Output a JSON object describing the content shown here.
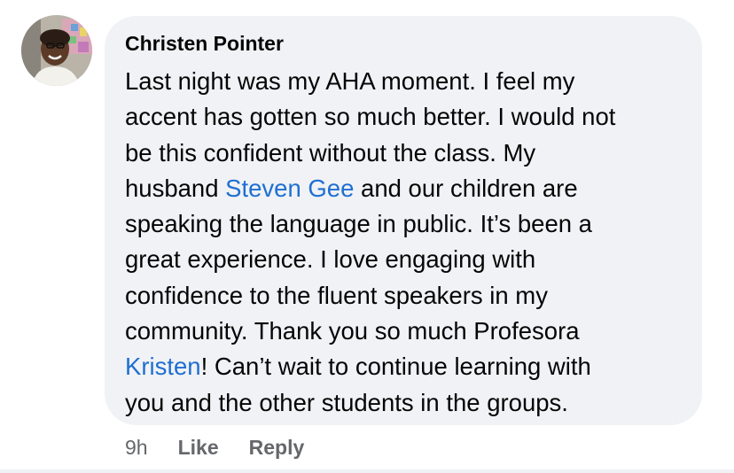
{
  "comment": {
    "author": "Christen Pointer",
    "lines": [
      [
        {
          "text": "Last night was my AHA moment. I feel my"
        }
      ],
      [
        {
          "text": "accent has gotten so much better. I would not"
        }
      ],
      [
        {
          "text": "be this confident without the class. My"
        }
      ],
      [
        {
          "text": "husband "
        },
        {
          "text": "Steven Gee",
          "mention": true
        },
        {
          "text": " and our children are"
        }
      ],
      [
        {
          "text": "speaking the language in public. It’s been a"
        }
      ],
      [
        {
          "text": "great experience. I love engaging with"
        }
      ],
      [
        {
          "text": "confidence to the fluent speakers in my"
        }
      ],
      [
        {
          "text": "community. Thank you so much Profesora"
        }
      ],
      [
        {
          "text": "Kristen",
          "mention": true
        },
        {
          "text": "! Can’t wait to continue learning with"
        }
      ],
      [
        {
          "text": "you and the other students in the groups."
        }
      ]
    ],
    "timestamp": "9h",
    "like_label": "Like",
    "reply_label": "Reply"
  },
  "colors": {
    "mention": "#1f6fd1",
    "bubble_bg": "#f0f2f5",
    "meta_text": "#65676b",
    "primary_text": "#050505"
  },
  "icons": {
    "avatar": "profile-photo"
  }
}
